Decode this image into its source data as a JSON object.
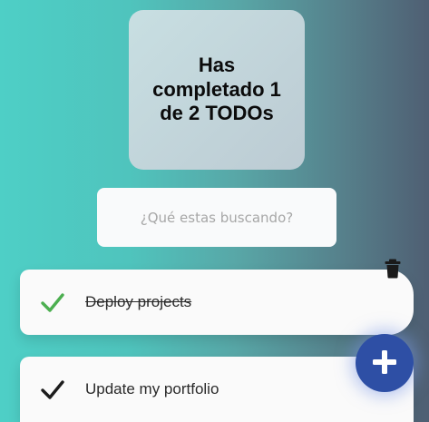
{
  "counter": {
    "text": "Has completado 1 de 2 TODOs"
  },
  "search": {
    "placeholder": "¿Qué estas buscando?",
    "value": ""
  },
  "todos": [
    {
      "text": "Deploy projects",
      "completed": true,
      "check_color": "#4caf50"
    },
    {
      "text": "Update my portfolio",
      "completed": false,
      "check_color": "#1c1c1c"
    }
  ],
  "icons": {
    "check": "check-icon",
    "delete": "trash-icon",
    "add": "plus-icon"
  },
  "colors": {
    "add_button": "#2e4fa5",
    "completed_check": "#4caf50"
  }
}
